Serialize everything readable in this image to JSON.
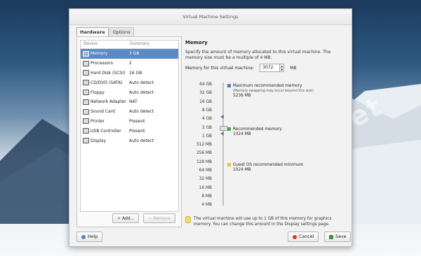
{
  "window": {
    "title": "Virtual Machine Settings"
  },
  "tabs": [
    {
      "label": "Hardware",
      "active": true
    },
    {
      "label": "Options",
      "active": false
    }
  ],
  "device_list": {
    "columns": [
      "Device",
      "Summary"
    ],
    "rows": [
      {
        "device": "Memory",
        "summary": "3 GB",
        "icon": "memory-icon",
        "selected": true
      },
      {
        "device": "Processors",
        "summary": "2",
        "icon": "processor-icon"
      },
      {
        "device": "Hard Disk (SCSI)",
        "summary": "16 GB",
        "icon": "hard-disk-icon"
      },
      {
        "device": "CD/DVD (SATA)",
        "summary": "Auto detect",
        "icon": "cd-dvd-icon"
      },
      {
        "device": "Floppy",
        "summary": "Auto detect",
        "icon": "floppy-icon"
      },
      {
        "device": "Network Adapter",
        "summary": "NAT",
        "icon": "network-icon"
      },
      {
        "device": "Sound Card",
        "summary": "Auto detect",
        "icon": "sound-card-icon"
      },
      {
        "device": "Printer",
        "summary": "Present",
        "icon": "printer-icon"
      },
      {
        "device": "USB Controller",
        "summary": "Present",
        "icon": "usb-icon"
      },
      {
        "device": "Display",
        "summary": "Auto detect",
        "icon": "display-icon"
      }
    ],
    "add_label": "Add...",
    "remove_label": "Remove"
  },
  "memory": {
    "section_title": "Memory",
    "description": "Specify the amount of memory allocated to this virtual machine. The memory size must be a multiple of 4 MB.",
    "field_label": "Memory for this virtual machine:",
    "value": "3072",
    "unit": "MB",
    "scale": [
      "64 GB",
      "32 GB",
      "16 GB",
      "8 GB",
      "4 GB",
      "2 GB",
      "1 GB",
      "512 MB",
      "256 MB",
      "128 MB",
      "64 MB",
      "32 MB",
      "16 MB",
      "8 MB",
      "4 MB"
    ],
    "max_recommended": {
      "title": "Maximum recommended memory",
      "note": "(Memory swapping may occur beyond this size)",
      "value": "5236 MB",
      "color": "#4a7fc1"
    },
    "recommended": {
      "title": "Recommended memory",
      "value": "1024 MB",
      "color": "#4ea24e"
    },
    "guest_min": {
      "title": "Guest OS recommended minimum",
      "value": "1024 MB",
      "color": "#e8c22a"
    },
    "note": "The virtual machine will use up to 1 GB of this memory for graphics memory. You can change this amount in the Display settings page."
  },
  "footer": {
    "help_label": "Help",
    "cancel_label": "Cancel",
    "save_label": "Save"
  },
  "watermark": "Lady-soft.net"
}
